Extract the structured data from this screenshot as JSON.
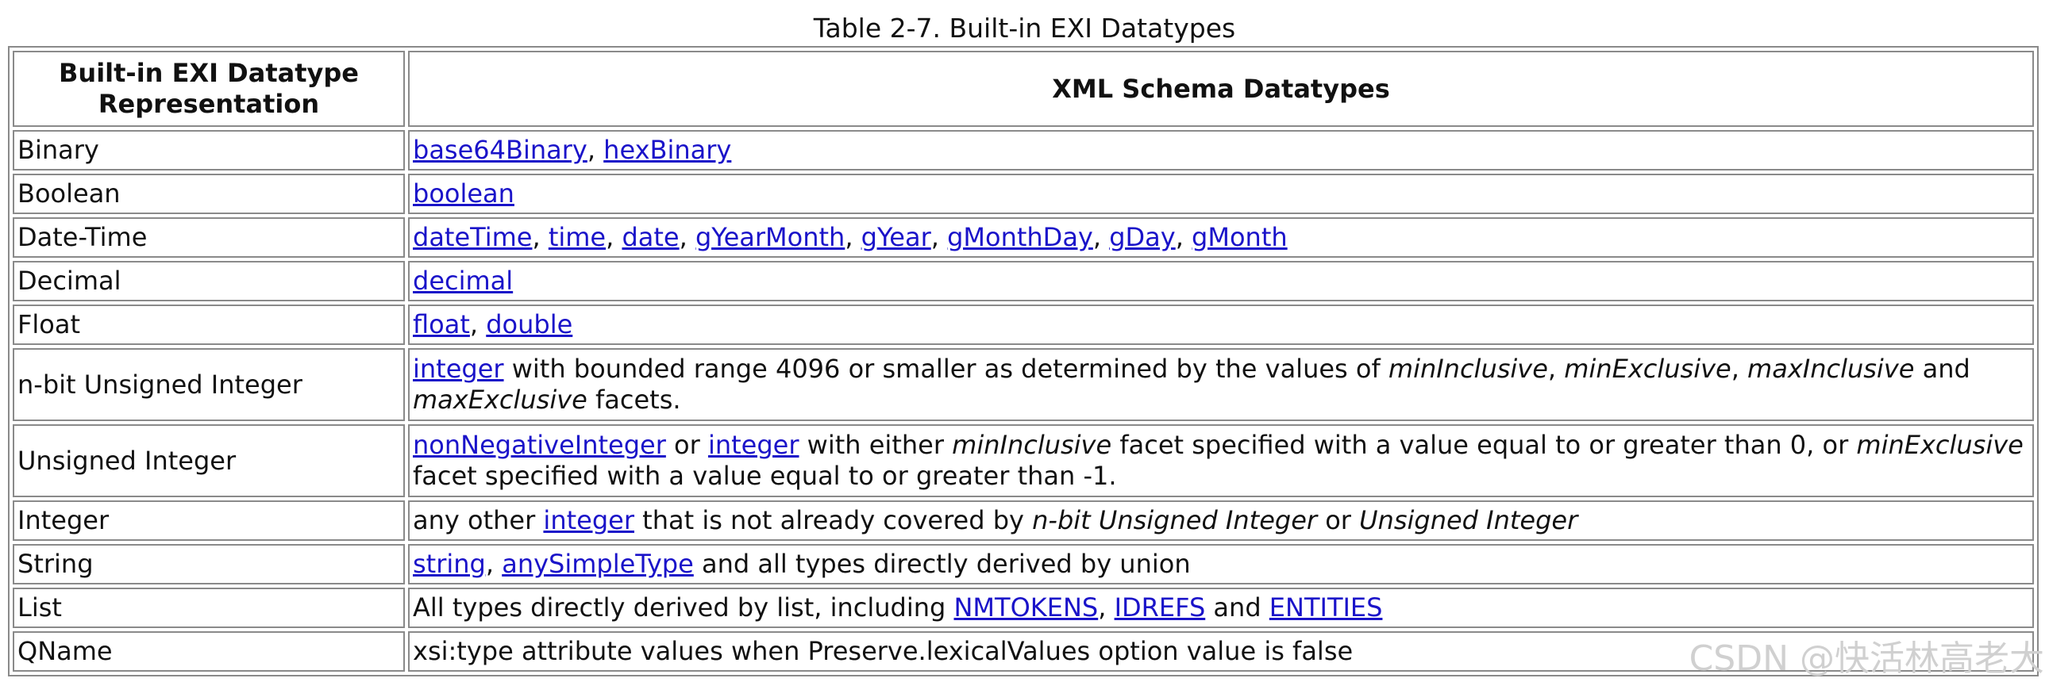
{
  "caption": "Table 2-7. Built-in EXI Datatypes",
  "columns": [
    "Built-in EXI Datatype Representation",
    "XML Schema Datatypes"
  ],
  "rows": [
    {
      "name": "Binary",
      "desc": [
        {
          "t": "base64Binary",
          "link": true
        },
        {
          "t": ", "
        },
        {
          "t": "hexBinary",
          "link": true
        }
      ]
    },
    {
      "name": "Boolean",
      "desc": [
        {
          "t": "boolean",
          "link": true
        }
      ]
    },
    {
      "name": "Date-Time",
      "desc": [
        {
          "t": "dateTime",
          "link": true
        },
        {
          "t": ", "
        },
        {
          "t": "time",
          "link": true
        },
        {
          "t": ", "
        },
        {
          "t": "date",
          "link": true
        },
        {
          "t": ", "
        },
        {
          "t": "gYearMonth",
          "link": true
        },
        {
          "t": ", "
        },
        {
          "t": "gYear",
          "link": true
        },
        {
          "t": ", "
        },
        {
          "t": "gMonthDay",
          "link": true
        },
        {
          "t": ", "
        },
        {
          "t": "gDay",
          "link": true
        },
        {
          "t": ", "
        },
        {
          "t": "gMonth",
          "link": true
        }
      ]
    },
    {
      "name": "Decimal",
      "desc": [
        {
          "t": "decimal",
          "link": true
        }
      ]
    },
    {
      "name": "Float",
      "desc": [
        {
          "t": "float",
          "link": true
        },
        {
          "t": ", "
        },
        {
          "t": "double",
          "link": true
        }
      ]
    },
    {
      "name": "n-bit Unsigned Integer",
      "tall": true,
      "desc": [
        {
          "t": "integer",
          "link": true
        },
        {
          "t": " with bounded range 4096 or smaller as determined by the values of "
        },
        {
          "t": "minInclusive",
          "em": true
        },
        {
          "t": ", "
        },
        {
          "t": "minExclusive",
          "em": true
        },
        {
          "t": ", "
        },
        {
          "t": "maxInclusive",
          "em": true
        },
        {
          "t": " and "
        },
        {
          "t": "maxExclusive",
          "em": true
        },
        {
          "t": " facets."
        }
      ]
    },
    {
      "name": "Unsigned Integer",
      "tall": true,
      "desc": [
        {
          "t": "nonNegativeInteger",
          "link": true
        },
        {
          "t": " or "
        },
        {
          "t": "integer",
          "link": true
        },
        {
          "t": " with either "
        },
        {
          "t": "minInclusive",
          "em": true
        },
        {
          "t": " facet specified with a value equal to or greater than 0, or "
        },
        {
          "t": "minExclusive",
          "em": true
        },
        {
          "t": " facet specified with a value equal to or greater than -1."
        }
      ]
    },
    {
      "name": "Integer",
      "desc": [
        {
          "t": "any other "
        },
        {
          "t": "integer",
          "link": true
        },
        {
          "t": " that is not already covered by "
        },
        {
          "t": "n-bit Unsigned Integer",
          "em": true
        },
        {
          "t": " or "
        },
        {
          "t": "Unsigned Integer",
          "em": true
        }
      ]
    },
    {
      "name": "String",
      "desc": [
        {
          "t": "string",
          "link": true
        },
        {
          "t": ", "
        },
        {
          "t": "anySimpleType",
          "link": true
        },
        {
          "t": " and all types directly derived by union"
        }
      ]
    },
    {
      "name": "List",
      "desc": [
        {
          "t": "All types directly derived by list, including "
        },
        {
          "t": "NMTOKENS",
          "link": true
        },
        {
          "t": ", "
        },
        {
          "t": "IDREFS",
          "link": true
        },
        {
          "t": " and "
        },
        {
          "t": "ENTITIES",
          "link": true
        }
      ]
    },
    {
      "name": "QName",
      "desc": [
        {
          "t": "xsi:type attribute values when Preserve.lexicalValues option value is false"
        }
      ]
    }
  ],
  "watermark": "CSDN @快活林高老大",
  "colors": {
    "link": "#1a13c9",
    "border": "#8a8a8a",
    "text": "#111111"
  }
}
